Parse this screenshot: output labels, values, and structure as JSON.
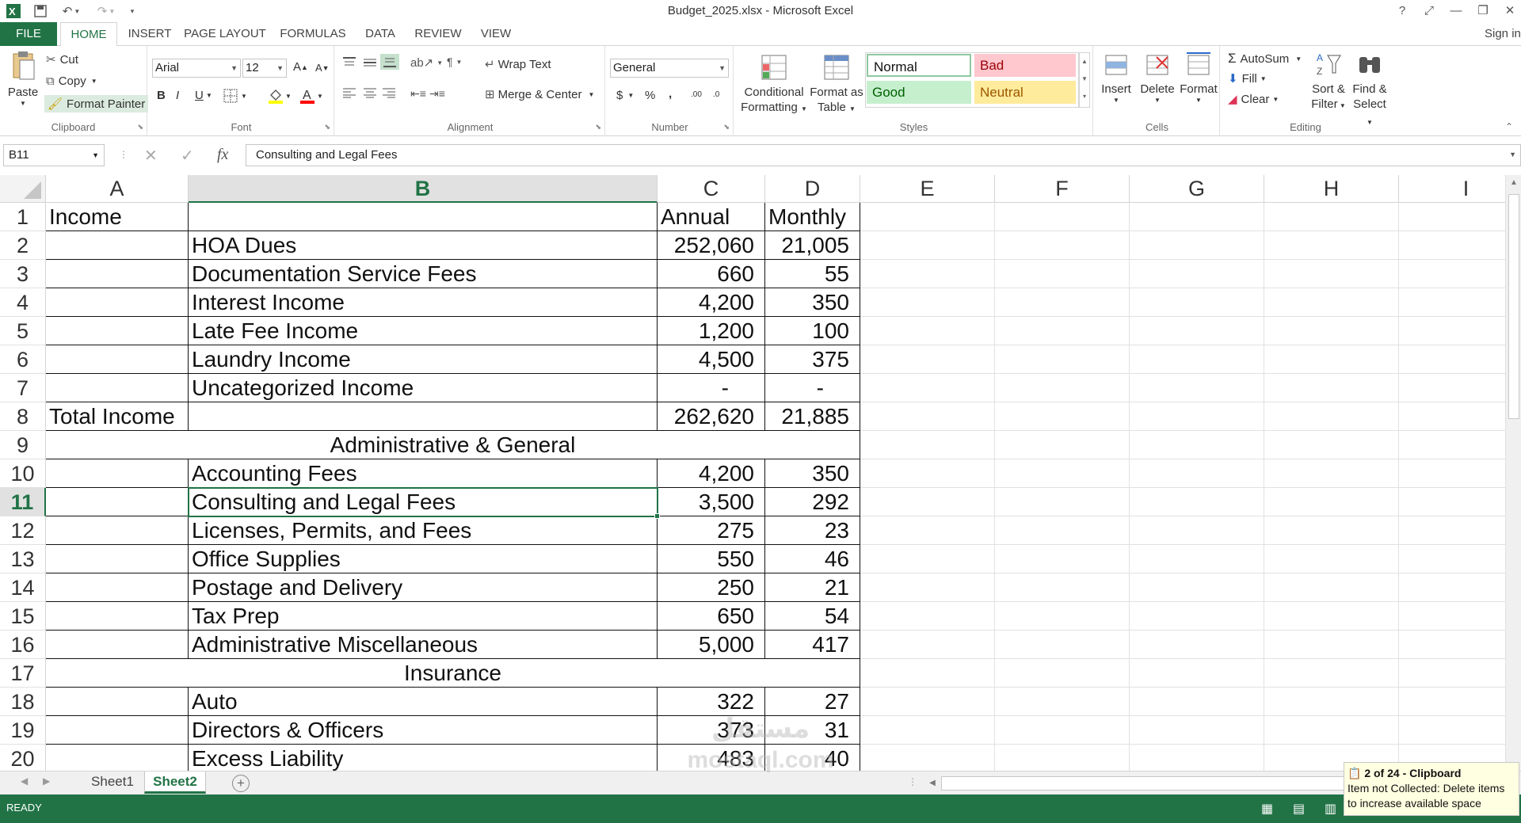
{
  "window": {
    "title": "Budget_2025.xlsx - Microsoft Excel",
    "help_icon": "?",
    "controls": {
      "ribbon_options": "⤢",
      "minimize": "—",
      "restore": "❐",
      "close": "✕"
    }
  },
  "ribbon_tabs": {
    "file": "FILE",
    "home": "HOME",
    "insert": "INSERT",
    "page_layout": "PAGE LAYOUT",
    "formulas": "FORMULAS",
    "data": "DATA",
    "review": "REVIEW",
    "view": "VIEW",
    "sign_in": "Sign in"
  },
  "clipboard": {
    "paste": "Paste",
    "cut": "Cut",
    "copy": "Copy",
    "format_painter": "Format Painter",
    "label": "Clipboard"
  },
  "font": {
    "name": "Arial",
    "size": "12",
    "bold": "B",
    "italic": "I",
    "underline": "U",
    "label": "Font",
    "grow": "A",
    "shrink": "A"
  },
  "alignment": {
    "wrap_text": "Wrap Text",
    "merge_center": "Merge & Center",
    "label": "Alignment"
  },
  "number": {
    "format": "General",
    "currency": "$",
    "percent": "%",
    "comma": ",",
    "inc_decimal": ".00",
    "dec_decimal": ".0",
    "label": "Number"
  },
  "styles": {
    "conditional_formatting": [
      "Conditional",
      "Formatting"
    ],
    "format_as_table": [
      "Format as",
      "Table"
    ],
    "normal": "Normal",
    "bad": "Bad",
    "good": "Good",
    "neutral": "Neutral",
    "label": "Styles",
    "colors": {
      "bad_bg": "#ffc7ce",
      "bad_fg": "#9c0006",
      "good_bg": "#c6efce",
      "good_fg": "#006100",
      "neutral_bg": "#ffeb9c",
      "neutral_fg": "#9c5700"
    }
  },
  "cells_group": {
    "insert": "Insert",
    "delete": "Delete",
    "format": "Format",
    "label": "Cells"
  },
  "editing": {
    "autosum": "AutoSum",
    "fill": "Fill",
    "clear": "Clear",
    "sort_filter": [
      "Sort &",
      "Filter"
    ],
    "find_select": [
      "Find &",
      "Select"
    ],
    "label": "Editing"
  },
  "formula_bar": {
    "name_box": "B11",
    "fx": "fx",
    "formula": "Consulting and Legal Fees"
  },
  "columns": [
    "A",
    "B",
    "C",
    "D",
    "E",
    "F",
    "G",
    "H",
    "I"
  ],
  "selected_column": "B",
  "selected_row": "11",
  "rows": [
    {
      "n": "1",
      "a": "Income",
      "b": "",
      "c": "Annual",
      "d": "Monthly"
    },
    {
      "n": "2",
      "a": "",
      "b": "HOA Dues",
      "c": "252,060",
      "d": "21,005"
    },
    {
      "n": "3",
      "a": "",
      "b": "Documentation Service Fees",
      "c": "660",
      "d": "55"
    },
    {
      "n": "4",
      "a": "",
      "b": "Interest Income",
      "c": "4,200",
      "d": "350"
    },
    {
      "n": "5",
      "a": "",
      "b": "Late Fee Income",
      "c": "1,200",
      "d": "100"
    },
    {
      "n": "6",
      "a": "",
      "b": "Laundry Income",
      "c": "4,500",
      "d": "375"
    },
    {
      "n": "7",
      "a": "",
      "b": "Uncategorized Income",
      "c": "-",
      "d": "-"
    },
    {
      "n": "8",
      "a": "Total Income",
      "b": "",
      "c": "262,620",
      "d": "21,885"
    },
    {
      "n": "9",
      "section": "Administrative & General"
    },
    {
      "n": "10",
      "a": "",
      "b": "Accounting Fees",
      "c": "4,200",
      "d": "350"
    },
    {
      "n": "11",
      "a": "",
      "b": "Consulting and Legal Fees",
      "c": "3,500",
      "d": "292"
    },
    {
      "n": "12",
      "a": "",
      "b": "Licenses, Permits, and Fees",
      "c": "275",
      "d": "23"
    },
    {
      "n": "13",
      "a": "",
      "b": "Office Supplies",
      "c": "550",
      "d": "46"
    },
    {
      "n": "14",
      "a": "",
      "b": "Postage and Delivery",
      "c": "250",
      "d": "21"
    },
    {
      "n": "15",
      "a": "",
      "b": "Tax Prep",
      "c": "650",
      "d": "54"
    },
    {
      "n": "16",
      "a": "",
      "b": "Administrative Miscellaneous",
      "c": "5,000",
      "d": "417"
    },
    {
      "n": "17",
      "section": "Insurance"
    },
    {
      "n": "18",
      "a": "",
      "b": "Auto",
      "c": "322",
      "d": "27"
    },
    {
      "n": "19",
      "a": "",
      "b": "Directors & Officers",
      "c": "373",
      "d": "31"
    },
    {
      "n": "20",
      "a": "",
      "b": "Excess Liability",
      "c": "483",
      "d": "40"
    }
  ],
  "sheets": [
    "Sheet1",
    "Sheet2"
  ],
  "active_sheet": "Sheet2",
  "status": "READY",
  "clipboard_note": {
    "title": "2 of 24 - Clipboard",
    "line1": "Item not Collected: Delete items",
    "line2": "to increase available space"
  },
  "watermark": [
    "مستقل",
    "mostaql.com"
  ],
  "accent_color": "#217346"
}
